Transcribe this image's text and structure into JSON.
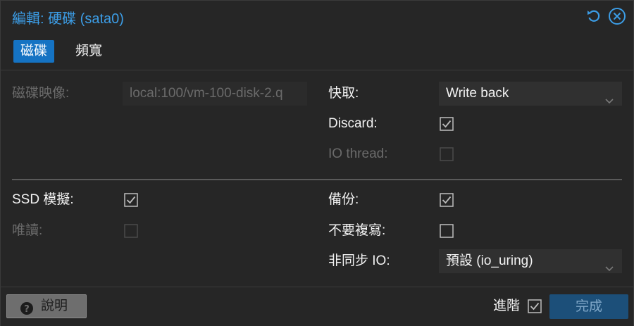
{
  "window": {
    "title": "編輯: 硬碟 (sata0)",
    "icons": {
      "reset": "reset-icon",
      "close": "close-icon"
    }
  },
  "tabs": [
    {
      "label": "磁碟",
      "active": true
    },
    {
      "label": "頻寬",
      "active": false
    }
  ],
  "form": {
    "disk_image": {
      "label": "磁碟映像:",
      "value": "local:100/vm-100-disk-2.q",
      "disabled": true
    },
    "cache": {
      "label": "快取:",
      "value": "Write back"
    },
    "discard": {
      "label": "Discard:",
      "checked": true
    },
    "io_thread": {
      "label": "IO thread:",
      "checked": false,
      "disabled": true
    },
    "ssd_emulation": {
      "label": "SSD 模擬:",
      "checked": true
    },
    "read_only": {
      "label": "唯讀:",
      "checked": false,
      "disabled": true
    },
    "backup": {
      "label": "備份:",
      "checked": true
    },
    "skip_replication": {
      "label": "不要複寫:",
      "checked": false
    },
    "async_io": {
      "label": "非同步 IO:",
      "value": "預設 (io_uring)"
    }
  },
  "footer": {
    "help_label": "說明",
    "advanced_label": "進階",
    "advanced_checked": true,
    "ok_label": "完成"
  },
  "colors": {
    "accent": "#3c9de6",
    "active_tab": "#1573c3",
    "ok_button": "#1c4f79",
    "background": "#262626"
  }
}
